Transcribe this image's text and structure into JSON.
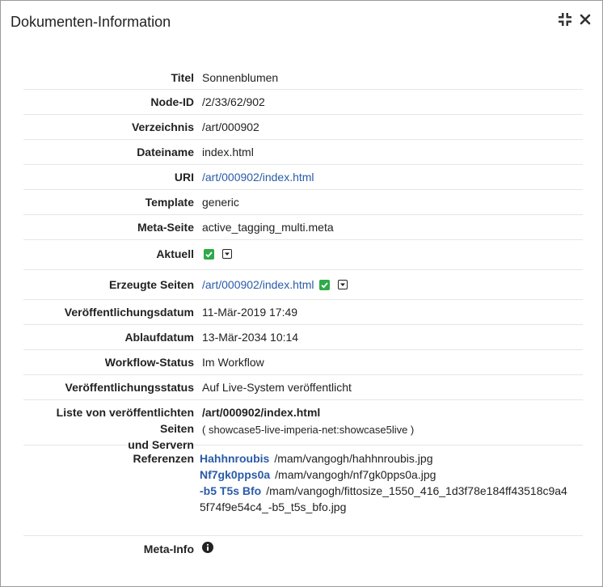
{
  "dialog": {
    "title": "Dokumenten-Information",
    "collapse_icon": "compress-icon",
    "close_icon": "close-icon"
  },
  "fields": {
    "titel": {
      "label": "Titel",
      "value": "Sonnenblumen"
    },
    "node_id": {
      "label": "Node-ID",
      "value": "/2/33/62/902"
    },
    "verzeichnis": {
      "label": "Verzeichnis",
      "value": "/art/000902"
    },
    "dateiname": {
      "label": "Dateiname",
      "value": "index.html"
    },
    "uri": {
      "label": "URI",
      "value": "/art/000902/index.html"
    },
    "template": {
      "label": "Template",
      "value": "generic"
    },
    "meta_seite": {
      "label": "Meta-Seite",
      "value": "active_tagging_multi.meta"
    },
    "aktuell": {
      "label": "Aktuell",
      "checked": true
    },
    "erzeugte_seiten": {
      "label": "Erzeugte Seiten",
      "value": "/art/000902/index.html",
      "checked": true
    },
    "veroeffentlichungsdatum": {
      "label": "Veröffentlichungsdatum",
      "value": "11-Mär-2019 17:49"
    },
    "ablaufdatum": {
      "label": "Ablaufdatum",
      "value": "13-Mär-2034 10:14"
    },
    "workflow_status": {
      "label": "Workflow-Status",
      "value": "Im Workflow"
    },
    "veroeffentlichungsstatus": {
      "label": "Veröffentlichungsstatus",
      "value": "Auf Live-System veröffentlicht"
    },
    "liste": {
      "label_line1": "Liste von veröffentlichten Seiten",
      "label_line2": "und Servern",
      "page": "/art/000902/index.html",
      "server": "( showcase5-live-imperia-net:showcase5live )"
    },
    "referenzen": {
      "label": "Referenzen",
      "items": [
        {
          "name": "Hahhnroubis",
          "path": "/mam/vangogh/hahhnroubis.jpg"
        },
        {
          "name": "Nf7gk0pps0a",
          "path": "/mam/vangogh/nf7gk0pps0a.jpg"
        },
        {
          "name": "-b5 T5s Bfo",
          "path": "/mam/vangogh/fittosize_1550_416_1d3f78e184ff43518c9a4",
          "path_cont": "5f74f9e54c4_-b5_t5s_bfo.jpg"
        }
      ]
    },
    "meta_info": {
      "label": "Meta-Info",
      "icon": "info-icon"
    }
  },
  "colors": {
    "link": "#2a5ba8",
    "check": "#2eaa4a",
    "divider": "#e6e6e6"
  }
}
